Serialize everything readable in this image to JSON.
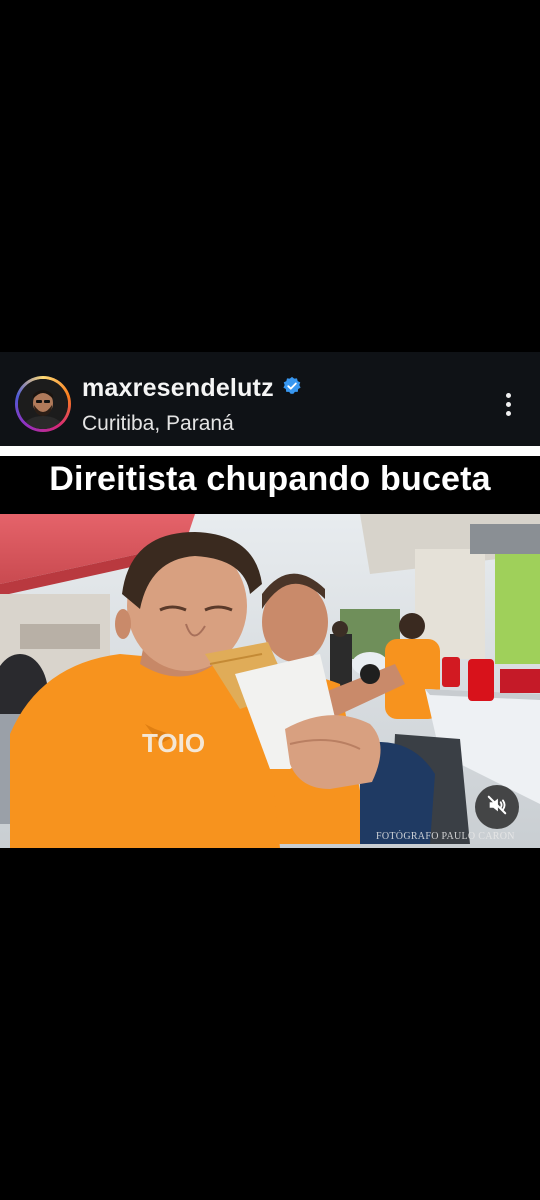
{
  "post": {
    "username": "maxresendelutz",
    "verified": true,
    "location": "Curitiba, Paraná",
    "more_icon": "more-vertical-icon"
  },
  "media": {
    "caption": "Direitista chupando buceta",
    "photo_credit": "FOTÓGRAFO PAULO CARON",
    "muted": true,
    "mute_icon": "speaker-muted-icon"
  },
  "colors": {
    "background": "#000000",
    "header_bg": "#0f1216",
    "verified_blue": "#3897f0",
    "shirt_orange": "#f7931e"
  }
}
